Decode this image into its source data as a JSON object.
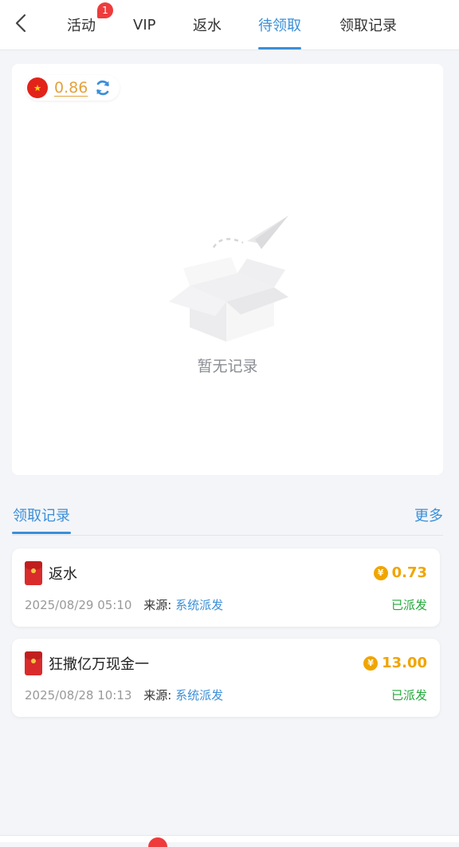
{
  "nav": {
    "back_icon": "chevron-left-icon",
    "tabs": [
      {
        "label": "活动",
        "badge": "1"
      },
      {
        "label": "VIP"
      },
      {
        "label": "返水"
      },
      {
        "label": "待领取",
        "active": true
      },
      {
        "label": "领取记录"
      }
    ]
  },
  "balance": {
    "flag_icon": "china-flag-icon",
    "value": "0.86",
    "refresh_icon": "refresh-icon"
  },
  "empty_state": {
    "icon": "empty-box-icon",
    "text": "暂无记录"
  },
  "records": {
    "title": "领取记录",
    "more": "更多",
    "items": [
      {
        "icon": "red-envelope-icon",
        "name": "返水",
        "amount": "0.73",
        "date": "2025/08/29 05:10",
        "source_label": "来源:",
        "source": "系统派发",
        "status": "已派发"
      },
      {
        "icon": "red-envelope-icon",
        "name": "狂撒亿万现金一",
        "amount": "13.00",
        "date": "2025/08/28 10:13",
        "source_label": "来源:",
        "source": "系统派发",
        "status": "已派发"
      }
    ]
  },
  "colors": {
    "accent": "#3b8fd8",
    "amount": "#f0a500",
    "status": "#22a83a",
    "badge": "#ee3b3b"
  }
}
